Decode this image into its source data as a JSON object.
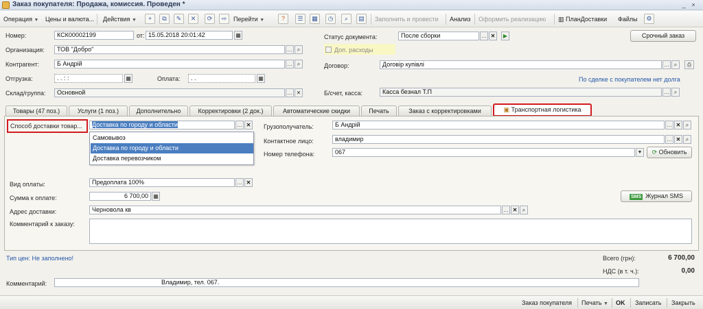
{
  "window": {
    "title": "Заказ покупателя: Продажа, комиссия. Проведен *"
  },
  "toolbar": {
    "operation": "Операция",
    "prices": "Цены и валюта...",
    "actions": "Действия",
    "goto": "Перейти",
    "fill_and_post": "Заполнить и провести",
    "analysis": "Анализ",
    "realization": "Оформить реализацию",
    "delivery_plan": "ПланДоставки",
    "files": "Файлы"
  },
  "header": {
    "number_label": "Номер:",
    "number_value": "КСК00002199",
    "date_label": "от:",
    "date_value": "15.05.2018 20:01:42",
    "org_label": "Организация:",
    "org_value": "ТОВ \"Добро\"",
    "counterparty_label": "Контрагент:",
    "counterparty_value": "Б          Андрій",
    "shipment_label": "Отгрузка:",
    "shipment_value": ". .     :    :",
    "payment_label": "Оплата:",
    "payment_value": ". .",
    "warehouse_label": "Склад/группа:",
    "warehouse_value": "Основной",
    "status_label": "Статус документа:",
    "status_value": "После сборки",
    "urgent_button": "Срочный заказ",
    "extra_expenses": "Доп. расходы",
    "contract_label": "Договор:",
    "contract_value": "Договір купівлі",
    "deal_link": "По сделке с покупателем нет долга",
    "account_label": "Б/счет, касса:",
    "account_value": "Касса безнал                                   Т.П"
  },
  "tabs": [
    {
      "label": "Товары (47 поз.)"
    },
    {
      "label": "Услуги (1 поз.)"
    },
    {
      "label": "Дополнительно"
    },
    {
      "label": "Корректировки (2 док.)"
    },
    {
      "label": "Автоматические скидки"
    },
    {
      "label": "Печать"
    },
    {
      "label": "Заказ с корректировками"
    },
    {
      "label": "Транспортная логистика"
    }
  ],
  "logistics": {
    "delivery_method_label": "Способ доставки товар...",
    "delivery_method_value": "Доставка по городу и области",
    "options": [
      "Самовывоз",
      "Доставка по городу и области",
      "Доставка перевозчиком"
    ],
    "selected_option_index": 1,
    "consignee_label": "Грузополучатель:",
    "consignee_value": "Б          Андрій",
    "contact_label": "Контактное лицо:",
    "contact_value": "владимир",
    "phone_label": "Номер телефона:",
    "phone_value": "067",
    "refresh_button": "Обновить",
    "payment_type_label": "Вид оплаты:",
    "payment_type_value": "Предоплата 100%",
    "amount_label": "Сумма к оплате:",
    "amount_value": "6 700,00",
    "sms_badge": "SMS",
    "sms_button": "Журнал SMS",
    "address_label": "Адрес доставки:",
    "address_value": "Черновола       кв",
    "comment_label": "Комментарий к заказу:",
    "comment_value": ""
  },
  "footer": {
    "price_type_link": "Тип цен: Не заполнено!",
    "total_label": "Всего (грн):",
    "total_value": "6 700,00",
    "vat_label": "НДС (в т. ч.):",
    "vat_value": "0,00",
    "comment_label": "Комментарий:",
    "comment_value": "Владимир, тел. 067."
  },
  "bottombar": {
    "order_doc": "Заказ покупателя",
    "print": "Печать",
    "ok": "OK",
    "save": "Записать",
    "close": "Закрыть"
  },
  "colors": {
    "highlight_red": "#d21b20",
    "selection_blue": "#4a7ec0",
    "link_blue": "#2456a8"
  }
}
